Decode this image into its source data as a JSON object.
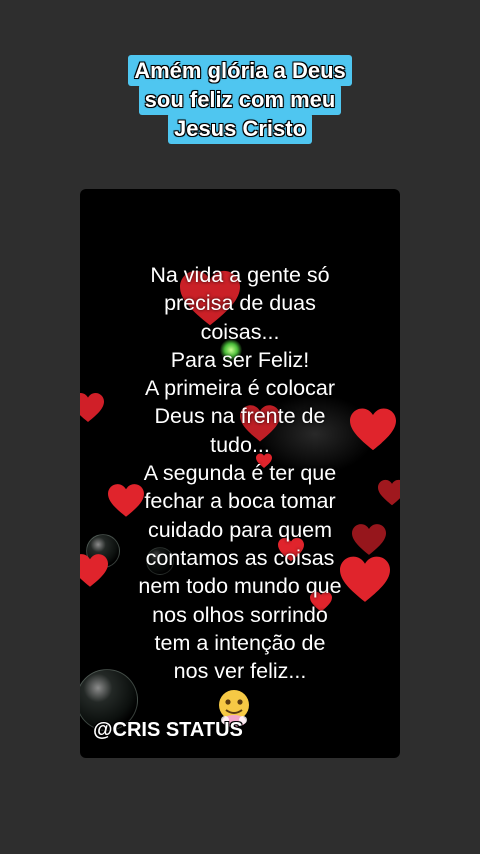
{
  "header": {
    "title_lines": [
      "Amém glória a Deus",
      "sou feliz com meu",
      "Jesus Cristo"
    ]
  },
  "video": {
    "poem_lines": [
      "Na vida a gente só",
      "precisa de duas",
      "coisas...",
      "Para ser Feliz!",
      "A primeira é colocar",
      "Deus na frente de",
      "tudo...",
      "A segunda é ter que",
      "fechar a boca tomar",
      "cuidado para quem",
      "contamos as coisas",
      "nem todo mundo que",
      "nos olhos sorrindo",
      "tem a intenção de",
      "nos ver feliz..."
    ],
    "watermark": "@CRIS STATUS",
    "heart_color": "#e0242c",
    "decor_icons": [
      "heart-icon",
      "bubble-icon",
      "money-face-emoji-icon"
    ]
  },
  "colors": {
    "background": "#2e2e2e",
    "title_highlight": "#4fc6f0",
    "card": "#000000"
  }
}
